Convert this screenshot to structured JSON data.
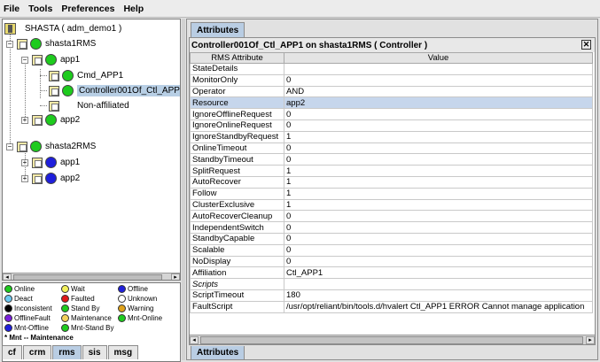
{
  "menu": [
    "File",
    "Tools",
    "Preferences",
    "Help"
  ],
  "tree": {
    "root": "SHASTA ( adm_demo1 )",
    "nodes": [
      {
        "label": "shasta1RMS",
        "state": "green"
      },
      {
        "label": "app1",
        "state": "green"
      },
      {
        "label": "Cmd_APP1",
        "state": "green"
      },
      {
        "label": "Controller001Of_Ctl_APP",
        "state": "green"
      },
      {
        "label": "Non-affiliated",
        "state": "none"
      },
      {
        "label": "app2",
        "state": "green"
      },
      {
        "label": "shasta2RMS",
        "state": "green"
      },
      {
        "label": "app1",
        "state": "blue"
      },
      {
        "label": "app2",
        "state": "blue"
      }
    ]
  },
  "legend": {
    "items": [
      {
        "label": "Online",
        "color": "#1ecb1e"
      },
      {
        "label": "Wait",
        "color": "#f3f15b"
      },
      {
        "label": "Offline",
        "color": "#1f1fdc"
      },
      {
        "label": "Deact",
        "color": "#6cc8f0"
      },
      {
        "label": "Faulted",
        "color": "#e01a1a"
      },
      {
        "label": "Unknown",
        "color": "#ffffff"
      },
      {
        "label": "Inconsistent",
        "color": "#000000"
      },
      {
        "label": "Stand By",
        "color": "#1ecb1e"
      },
      {
        "label": "Warning",
        "color": "#e0a21a"
      },
      {
        "label": "OfflineFault",
        "color": "#7a1fdc"
      },
      {
        "label": "Maintenance",
        "color": "#f3d15b"
      },
      {
        "label": "Mnt-Online",
        "color": "#1ecb1e"
      },
      {
        "label": "Mnt-Offline",
        "color": "#1f1fdc"
      },
      {
        "label": "Mnt-Stand By",
        "color": "#1ecb1e"
      }
    ],
    "note": "* Mnt -- Maintenance"
  },
  "left_tabs": [
    "cf",
    "crm",
    "rms",
    "sis",
    "msg"
  ],
  "active_left_tab": "rms",
  "attributes": {
    "tab_label": "Attributes",
    "title": "Controller001Of_Ctl_APP1 on shasta1RMS ( Controller )",
    "col_attr": "RMS Attribute",
    "col_value": "Value",
    "rows": [
      {
        "name": "StateDetails",
        "value": ""
      },
      {
        "name": "MonitorOnly",
        "value": "0"
      },
      {
        "name": "Operator",
        "value": "AND"
      },
      {
        "name": "Resource",
        "value": "app2"
      },
      {
        "name": "IgnoreOfflineRequest",
        "value": "0"
      },
      {
        "name": "IgnoreOnlineRequest",
        "value": "0"
      },
      {
        "name": "IgnoreStandbyRequest",
        "value": "1"
      },
      {
        "name": "OnlineTimeout",
        "value": "0"
      },
      {
        "name": "StandbyTimeout",
        "value": "0"
      },
      {
        "name": "SplitRequest",
        "value": "1"
      },
      {
        "name": "AutoRecover",
        "value": "1"
      },
      {
        "name": "Follow",
        "value": "1"
      },
      {
        "name": "ClusterExclusive",
        "value": "1"
      },
      {
        "name": "AutoRecoverCleanup",
        "value": "0"
      },
      {
        "name": "IndependentSwitch",
        "value": "0"
      },
      {
        "name": "StandbyCapable",
        "value": "0"
      },
      {
        "name": "Scalable",
        "value": "0"
      },
      {
        "name": "NoDisplay",
        "value": "0"
      },
      {
        "name": "Affiliation",
        "value": "Ctl_APP1"
      },
      {
        "name": "Scripts",
        "value": ""
      },
      {
        "name": "ScriptTimeout",
        "value": "180"
      },
      {
        "name": "FaultScript",
        "value": "/usr/opt/reliant/bin/tools.d/hvalert Ctl_APP1 ERROR Cannot manage application"
      }
    ]
  }
}
